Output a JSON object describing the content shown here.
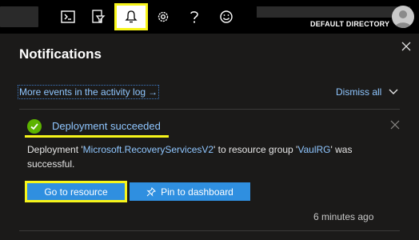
{
  "topbar": {
    "icons": [
      "cloud-shell-icon",
      "directory-filter-icon",
      "bell-icon",
      "gear-icon",
      "help-icon",
      "feedback-smiley-icon"
    ],
    "directory_label": "DEFAULT DIRECTORY"
  },
  "panel": {
    "title": "Notifications",
    "activity_log_link": "More events in the activity log",
    "activity_log_arrow": "→",
    "dismiss_all": "Dismiss all"
  },
  "notification": {
    "title": "Deployment succeeded",
    "body_prefix": "Deployment '",
    "resource_name": "Microsoft.RecoveryServicesV2",
    "body_middle": "' to resource group '",
    "resource_group": "VaulRG",
    "body_suffix": "' was successful.",
    "primary_button": "Go to resource",
    "secondary_button": "Pin to dashboard",
    "timestamp": "6 minutes ago"
  },
  "colors": {
    "link": "#8fc6ff",
    "accent_button": "#2f8fe0",
    "highlight": "#f7f51a",
    "success": "#5db300",
    "panel_bg": "#1b1a19"
  }
}
